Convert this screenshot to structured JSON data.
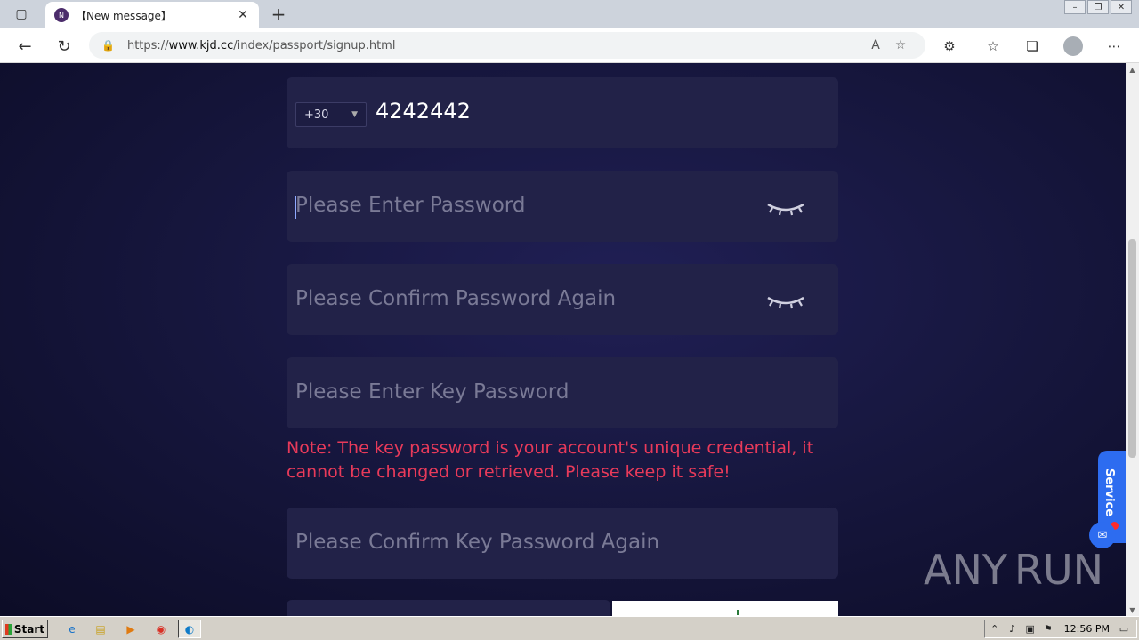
{
  "browser": {
    "tab_title": "【New message】",
    "tab_favicon_letter": "N",
    "url_prefix": "https://",
    "url_host": "www.kjd.cc",
    "url_path": "/index/passport/signup.html"
  },
  "form": {
    "country_code": "+30",
    "phone_value": "4242442",
    "password_placeholder": "Please Enter Password",
    "confirm_password_placeholder": "Please Confirm Password Again",
    "key_password_placeholder": "Please Enter Key Password",
    "note": "Note: The key password is your account's unique credential, it cannot be changed or retrieved. Please keep it safe!",
    "confirm_key_password_placeholder": "Please Confirm Key Password Again"
  },
  "service": {
    "label": "Service"
  },
  "watermark": {
    "left": "ANY",
    "right": "RUN"
  },
  "taskbar": {
    "start_label": "Start",
    "clock": "12:56 PM"
  },
  "colors": {
    "note": "#e83a5a",
    "field_bg": "#222248",
    "service": "#2d6cf0"
  }
}
